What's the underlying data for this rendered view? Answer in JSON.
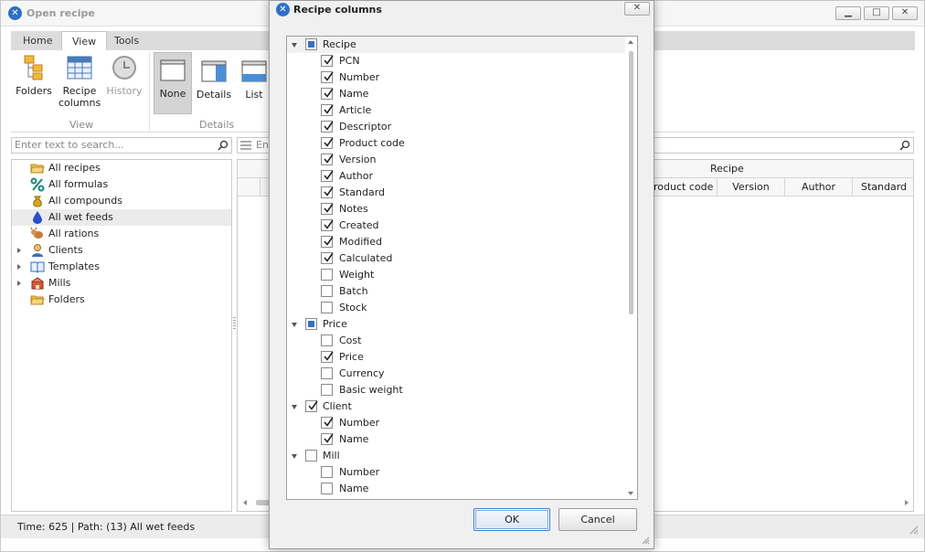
{
  "window": {
    "title": "Open recipe",
    "min_glyph": "▁",
    "max_glyph": "□",
    "close_glyph": "✕"
  },
  "ribbon": {
    "tabs": [
      "Home",
      "View",
      "Tools"
    ],
    "active_tab": "View",
    "buttons": {
      "folders": "Folders",
      "recipe_columns_line1": "Recipe",
      "recipe_columns_line2": "columns",
      "history": "History",
      "none": "None",
      "details": "Details",
      "list": "List"
    },
    "groups": {
      "view": "View",
      "details": "Details"
    }
  },
  "left": {
    "search_placeholder": "Enter text to search...",
    "tree": [
      {
        "label": "All recipes",
        "icon": "folder-open-icon",
        "expandable": false
      },
      {
        "label": "All formulas",
        "icon": "percent-icon",
        "expandable": false
      },
      {
        "label": "All compounds",
        "icon": "money-bag-icon",
        "expandable": false
      },
      {
        "label": "All wet feeds",
        "icon": "water-drop-icon",
        "expandable": false,
        "selected": true
      },
      {
        "label": "All rations",
        "icon": "animal-icon",
        "expandable": false
      },
      {
        "label": "Clients",
        "icon": "person-icon",
        "expandable": true
      },
      {
        "label": "Templates",
        "icon": "book-icon",
        "expandable": true
      },
      {
        "label": "Mills",
        "icon": "mill-icon",
        "expandable": true
      },
      {
        "label": "Folders",
        "icon": "folder-icon",
        "expandable": false
      }
    ]
  },
  "right": {
    "search_placeholder_partial": "Ent",
    "band_label": "Recipe",
    "columns": [
      "roduct code",
      "Version",
      "Author",
      "Standard"
    ]
  },
  "status": {
    "text": "Time: 625 | Path: (13) All wet feeds"
  },
  "dialog": {
    "title": "Recipe columns",
    "close_glyph": "✕",
    "ok_label": "OK",
    "cancel_label": "Cancel",
    "rows": [
      {
        "label": "Recipe",
        "level": 0,
        "state": "partial",
        "expander": true,
        "highlight": true
      },
      {
        "label": "PCN",
        "level": 1,
        "state": "checked"
      },
      {
        "label": "Number",
        "level": 1,
        "state": "checked"
      },
      {
        "label": "Name",
        "level": 1,
        "state": "checked"
      },
      {
        "label": "Article",
        "level": 1,
        "state": "checked"
      },
      {
        "label": "Descriptor",
        "level": 1,
        "state": "checked"
      },
      {
        "label": "Product code",
        "level": 1,
        "state": "checked"
      },
      {
        "label": "Version",
        "level": 1,
        "state": "checked"
      },
      {
        "label": "Author",
        "level": 1,
        "state": "checked"
      },
      {
        "label": "Standard",
        "level": 1,
        "state": "checked"
      },
      {
        "label": "Notes",
        "level": 1,
        "state": "checked"
      },
      {
        "label": "Created",
        "level": 1,
        "state": "checked"
      },
      {
        "label": "Modified",
        "level": 1,
        "state": "checked"
      },
      {
        "label": "Calculated",
        "level": 1,
        "state": "checked"
      },
      {
        "label": "Weight",
        "level": 1,
        "state": "unchecked"
      },
      {
        "label": "Batch",
        "level": 1,
        "state": "unchecked"
      },
      {
        "label": "Stock",
        "level": 1,
        "state": "unchecked"
      },
      {
        "label": "Price",
        "level": 0,
        "state": "partial",
        "expander": true
      },
      {
        "label": "Cost",
        "level": 1,
        "state": "unchecked"
      },
      {
        "label": "Price",
        "level": 1,
        "state": "checked"
      },
      {
        "label": "Currency",
        "level": 1,
        "state": "unchecked"
      },
      {
        "label": "Basic weight",
        "level": 1,
        "state": "unchecked"
      },
      {
        "label": "Client",
        "level": 0,
        "state": "checked",
        "expander": true
      },
      {
        "label": "Number",
        "level": 1,
        "state": "checked"
      },
      {
        "label": "Name",
        "level": 1,
        "state": "checked"
      },
      {
        "label": "Mill",
        "level": 0,
        "state": "unchecked",
        "expander": true
      },
      {
        "label": "Number",
        "level": 1,
        "state": "unchecked"
      },
      {
        "label": "Name",
        "level": 1,
        "state": "unchecked"
      },
      {
        "label": "",
        "level": 1,
        "state": "unchecked"
      }
    ]
  }
}
